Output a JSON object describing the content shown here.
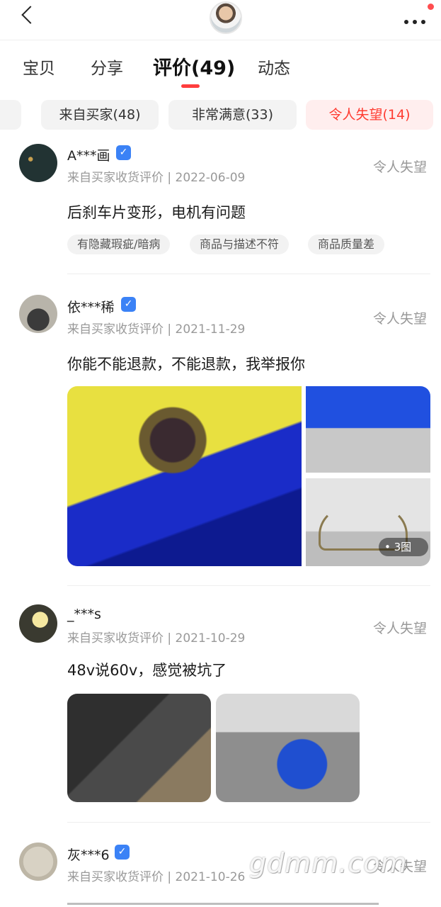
{
  "tabs": [
    {
      "label": "宝贝"
    },
    {
      "label": "分享"
    },
    {
      "label": "评价(49)"
    },
    {
      "label": "动态"
    }
  ],
  "filters": [
    {
      "label": "来自买家(48)"
    },
    {
      "label": "非常满意(33)"
    },
    {
      "label": "令人失望(14)"
    }
  ],
  "reviews": [
    {
      "user": "A***画",
      "meta": "来自买家收货评价 | 2022-06-09",
      "rating": "令人失望",
      "content": "后刹车片变形，电机有问题",
      "tags": [
        "有隐藏瑕疵/暗病",
        "商品与描述不符",
        "商品质量差"
      ]
    },
    {
      "user": "依***稀",
      "meta": "来自买家收货评价 | 2021-11-29",
      "rating": "令人失望",
      "content": "你能不能退款，不能退款，我举报你",
      "photo_count": "• 3图"
    },
    {
      "user": "_***s",
      "meta": "来自买家收货评价 | 2021-10-29",
      "rating": "令人失望",
      "content": "48v说60v，感觉被坑了"
    },
    {
      "user": "灰***6",
      "meta": "来自买家收货评价 | 2021-10-26",
      "rating": "令人失望"
    }
  ],
  "watermark": "gdmm.com",
  "icons": {
    "back": "back-arrow-icon",
    "more": "more-icon",
    "verify": "verified-icon"
  },
  "colors": {
    "accent": "#ff3b30",
    "verify": "#3b82f6",
    "muted": "#999999"
  }
}
